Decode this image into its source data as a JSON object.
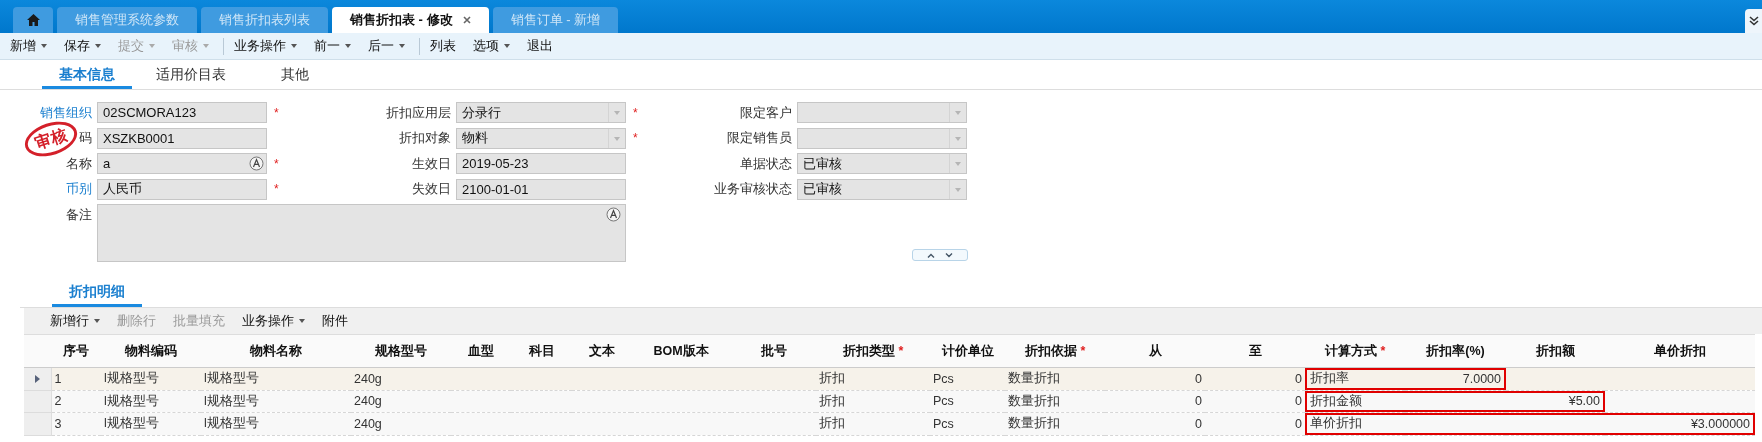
{
  "app_tabs": [
    {
      "kind": "home",
      "selected": false
    },
    {
      "kind": "page",
      "label": "销售管理系统参数",
      "selected": false
    },
    {
      "kind": "page",
      "label": "销售折扣表列表",
      "selected": false
    },
    {
      "kind": "page",
      "label": "销售折扣表 - 修改",
      "selected": true
    },
    {
      "kind": "page",
      "label": "销售订单 - 新增",
      "selected": false
    }
  ],
  "toolbar": [
    {
      "kind": "button",
      "label": "新增",
      "dropdown": true,
      "disabled": false
    },
    {
      "kind": "button",
      "label": "保存",
      "dropdown": true,
      "disabled": false
    },
    {
      "kind": "button",
      "label": "提交",
      "dropdown": true,
      "disabled": true
    },
    {
      "kind": "button",
      "label": "审核",
      "dropdown": true,
      "disabled": true
    },
    {
      "kind": "separator"
    },
    {
      "kind": "button",
      "label": "业务操作",
      "dropdown": true,
      "disabled": false
    },
    {
      "kind": "button",
      "label": "前一",
      "dropdown": true,
      "disabled": false
    },
    {
      "kind": "button",
      "label": "后一",
      "dropdown": true,
      "disabled": false
    },
    {
      "kind": "separator"
    },
    {
      "kind": "button",
      "label": "列表",
      "dropdown": false,
      "disabled": false
    },
    {
      "kind": "button",
      "label": "选项",
      "dropdown": true,
      "disabled": false
    },
    {
      "kind": "button",
      "label": "退出",
      "dropdown": false,
      "disabled": false
    }
  ],
  "form_tabs": [
    {
      "label": "基本信息",
      "selected": true
    },
    {
      "label": "适用价目表",
      "selected": false
    },
    {
      "label": "其他",
      "selected": false
    }
  ],
  "form": {
    "stamp": "审核",
    "columns": [
      [
        {
          "label": "销售组织",
          "link": true,
          "kind": "text",
          "value": "02SCMORA123",
          "required_mark": "*"
        },
        {
          "label": "码",
          "link": false,
          "kind": "text",
          "value": "XSZKB0001"
        },
        {
          "label": "名称",
          "link": false,
          "kind": "lookup",
          "value": "a",
          "required_mark": "*"
        },
        {
          "label": "币别",
          "link": true,
          "kind": "text",
          "value": "人民币",
          "required_mark": "*"
        },
        {
          "label": "备注",
          "link": false,
          "kind": "textarea"
        }
      ],
      [
        {
          "label": "折扣应用层",
          "link": false,
          "kind": "dropdown",
          "value": "分录行",
          "required_mark": "*"
        },
        {
          "label": "折扣对象",
          "link": false,
          "kind": "dropdown",
          "value": "物料",
          "required_mark": "*"
        },
        {
          "label": "生效日",
          "link": false,
          "kind": "text",
          "value": "2019-05-23"
        },
        {
          "label": "失效日",
          "link": false,
          "kind": "text",
          "value": "2100-01-01"
        }
      ],
      [
        {
          "label": "限定客户",
          "link": false,
          "kind": "dropdown"
        },
        {
          "label": "限定销售员",
          "link": false,
          "kind": "dropdown"
        },
        {
          "label": "单据状态",
          "link": false,
          "kind": "dropdown",
          "value": "已审核"
        },
        {
          "label": "业务审核状态",
          "link": false,
          "kind": "dropdown",
          "value": "已审核"
        }
      ]
    ]
  },
  "detail_tabs": [
    {
      "label": "折扣明细",
      "selected": true
    }
  ],
  "detail_toolbar": [
    {
      "kind": "button",
      "label": "新增行",
      "dropdown": true,
      "disabled": false
    },
    {
      "kind": "button",
      "label": "删除行",
      "dropdown": false,
      "disabled": true
    },
    {
      "kind": "button",
      "label": "批量填充",
      "dropdown": false,
      "disabled": true
    },
    {
      "kind": "button",
      "label": "业务操作",
      "dropdown": true,
      "disabled": false
    },
    {
      "kind": "button",
      "label": "附件",
      "dropdown": false,
      "disabled": false
    }
  ],
  "table": {
    "columns": [
      {
        "label": "序号"
      },
      {
        "label": "物料编码"
      },
      {
        "label": "物料名称"
      },
      {
        "label": "规格型号"
      },
      {
        "label": "血型"
      },
      {
        "label": "科目"
      },
      {
        "label": "文本"
      },
      {
        "label": "BOM版本"
      },
      {
        "label": "批号"
      },
      {
        "label": "折扣类型",
        "required_mark": "*"
      },
      {
        "label": "计价单位"
      },
      {
        "label": "折扣依据",
        "required_mark": "*"
      },
      {
        "label": "从"
      },
      {
        "label": "至"
      },
      {
        "label": "计算方式",
        "required_mark": "*"
      },
      {
        "label": "折扣率(%)"
      },
      {
        "label": "折扣额"
      },
      {
        "label": "单价折扣"
      }
    ],
    "rows": [
      {
        "selected": true,
        "cells": [
          {
            "text": "1",
            "framed": false
          },
          {
            "text": "l规格型号",
            "framed": false
          },
          {
            "text": "l规格型号",
            "framed": false
          },
          {
            "text": "240g",
            "framed": false
          },
          {
            "framed": false
          },
          {
            "framed": false
          },
          {
            "framed": false
          },
          {
            "framed": false
          },
          {
            "framed": false
          },
          {
            "text": "折扣",
            "framed": false
          },
          {
            "text": "Pcs",
            "framed": false
          },
          {
            "text": "数量折扣",
            "framed": false
          },
          {
            "text": "0",
            "framed": false
          },
          {
            "text": "0",
            "framed": false
          },
          {
            "text": "折扣率",
            "framed": true
          },
          {
            "text": "7.0000",
            "framed": true
          },
          {
            "framed": false
          },
          {
            "framed": false
          }
        ]
      },
      {
        "selected": false,
        "cells": [
          {
            "text": "2",
            "framed": false
          },
          {
            "text": "l规格型号",
            "framed": false
          },
          {
            "text": "l规格型号",
            "framed": false
          },
          {
            "text": "240g",
            "framed": false
          },
          {
            "framed": false
          },
          {
            "framed": false
          },
          {
            "framed": false
          },
          {
            "framed": false
          },
          {
            "framed": false
          },
          {
            "text": "折扣",
            "framed": false
          },
          {
            "text": "Pcs",
            "framed": false
          },
          {
            "text": "数量折扣",
            "framed": false
          },
          {
            "text": "0",
            "framed": false
          },
          {
            "text": "0",
            "framed": false
          },
          {
            "text": "折扣金额",
            "framed": true
          },
          {
            "framed": true
          },
          {
            "text": "¥5.00",
            "framed": true
          },
          {
            "framed": false
          }
        ]
      },
      {
        "selected": false,
        "cells": [
          {
            "text": "3",
            "framed": false
          },
          {
            "text": "l规格型号",
            "framed": false
          },
          {
            "text": "l规格型号",
            "framed": false
          },
          {
            "text": "240g",
            "framed": false
          },
          {
            "framed": false
          },
          {
            "framed": false
          },
          {
            "framed": false
          },
          {
            "framed": false
          },
          {
            "framed": false
          },
          {
            "text": "折扣",
            "framed": false
          },
          {
            "text": "Pcs",
            "framed": false
          },
          {
            "text": "数量折扣",
            "framed": false
          },
          {
            "text": "0",
            "framed": false
          },
          {
            "text": "0",
            "framed": false
          },
          {
            "text": "单价折扣",
            "framed": true
          },
          {
            "framed": true
          },
          {
            "framed": true
          },
          {
            "text": "¥3.000000",
            "framed": true
          }
        ]
      }
    ]
  }
}
